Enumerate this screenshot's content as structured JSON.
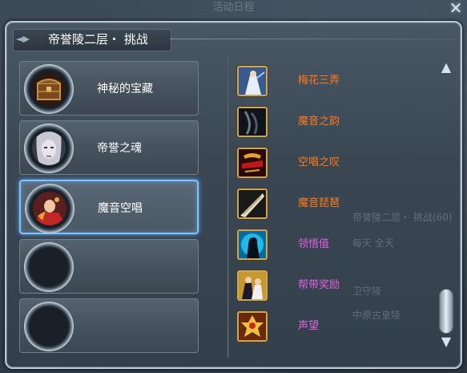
{
  "window": {
    "title_ghost": "活动日程",
    "close_glyph": "✕"
  },
  "header": {
    "title": "帝誉陵二层・ 挑战",
    "ornament": "◄▶"
  },
  "left_list": {
    "items": [
      {
        "label": "神秘的宝藏",
        "selected": false,
        "portrait": "treasure-chest"
      },
      {
        "label": "帝誉之魂",
        "selected": false,
        "portrait": "pale-ghost-face"
      },
      {
        "label": "魔音空唱",
        "selected": true,
        "portrait": "dancer-woman"
      },
      {
        "label": "",
        "selected": false,
        "portrait": "empty"
      },
      {
        "label": "",
        "selected": false,
        "portrait": "empty"
      }
    ]
  },
  "right_list": {
    "items": [
      {
        "label": "梅花三弄",
        "color": "#ff7a1a",
        "icon": "white-robed-skill-icon"
      },
      {
        "label": "魔音之韵",
        "color": "#ff7a1a",
        "icon": "dark-blade-icon"
      },
      {
        "label": "空唱之叹",
        "color": "#ff7a1a",
        "icon": "red-fire-icon"
      },
      {
        "label": "魔音琵琶",
        "color": "#ff7a1a",
        "icon": "pipa-instrument-icon"
      },
      {
        "label": "领悟值",
        "color": "#e060e0",
        "icon": "blue-silhouette-icon"
      },
      {
        "label": "帮带奖励",
        "color": "#e060e0",
        "icon": "two-figures-icon"
      },
      {
        "label": "声望",
        "color": "#e060e0",
        "icon": "golden-emblem-icon"
      }
    ]
  },
  "ghost_texts": [
    "帝誉陵二层・ 挑战(60)",
    "每天  全天",
    "卫守陵",
    "中原古皇陵"
  ],
  "scroll": {
    "up_glyph": "▲",
    "down_glyph": "▼"
  }
}
